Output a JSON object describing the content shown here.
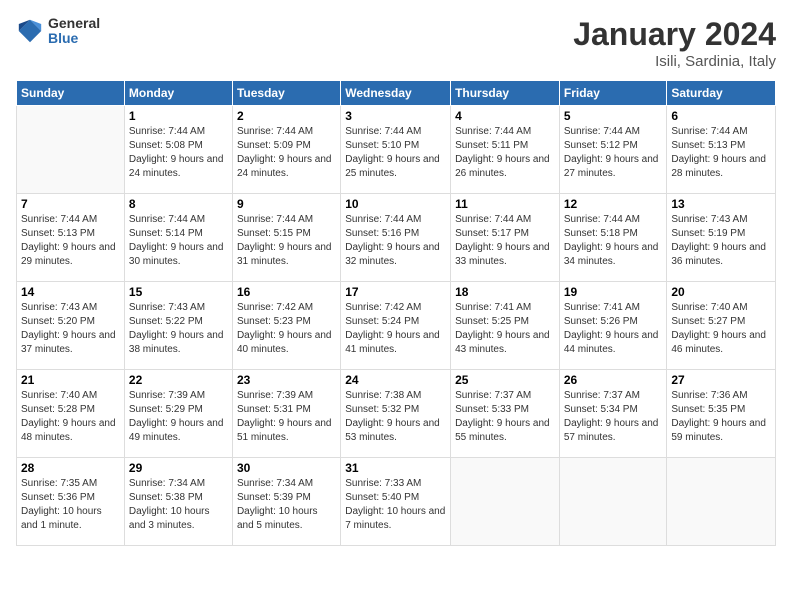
{
  "header": {
    "logo": {
      "general": "General",
      "blue": "Blue"
    },
    "title": "January 2024",
    "location": "Isili, Sardinia, Italy"
  },
  "calendar": {
    "days_of_week": [
      "Sunday",
      "Monday",
      "Tuesday",
      "Wednesday",
      "Thursday",
      "Friday",
      "Saturday"
    ],
    "weeks": [
      [
        {
          "day": "",
          "info": ""
        },
        {
          "day": "1",
          "sunrise": "Sunrise: 7:44 AM",
          "sunset": "Sunset: 5:08 PM",
          "daylight": "Daylight: 9 hours and 24 minutes."
        },
        {
          "day": "2",
          "sunrise": "Sunrise: 7:44 AM",
          "sunset": "Sunset: 5:09 PM",
          "daylight": "Daylight: 9 hours and 24 minutes."
        },
        {
          "day": "3",
          "sunrise": "Sunrise: 7:44 AM",
          "sunset": "Sunset: 5:10 PM",
          "daylight": "Daylight: 9 hours and 25 minutes."
        },
        {
          "day": "4",
          "sunrise": "Sunrise: 7:44 AM",
          "sunset": "Sunset: 5:11 PM",
          "daylight": "Daylight: 9 hours and 26 minutes."
        },
        {
          "day": "5",
          "sunrise": "Sunrise: 7:44 AM",
          "sunset": "Sunset: 5:12 PM",
          "daylight": "Daylight: 9 hours and 27 minutes."
        },
        {
          "day": "6",
          "sunrise": "Sunrise: 7:44 AM",
          "sunset": "Sunset: 5:13 PM",
          "daylight": "Daylight: 9 hours and 28 minutes."
        }
      ],
      [
        {
          "day": "7",
          "sunrise": "Sunrise: 7:44 AM",
          "sunset": "Sunset: 5:13 PM",
          "daylight": "Daylight: 9 hours and 29 minutes."
        },
        {
          "day": "8",
          "sunrise": "Sunrise: 7:44 AM",
          "sunset": "Sunset: 5:14 PM",
          "daylight": "Daylight: 9 hours and 30 minutes."
        },
        {
          "day": "9",
          "sunrise": "Sunrise: 7:44 AM",
          "sunset": "Sunset: 5:15 PM",
          "daylight": "Daylight: 9 hours and 31 minutes."
        },
        {
          "day": "10",
          "sunrise": "Sunrise: 7:44 AM",
          "sunset": "Sunset: 5:16 PM",
          "daylight": "Daylight: 9 hours and 32 minutes."
        },
        {
          "day": "11",
          "sunrise": "Sunrise: 7:44 AM",
          "sunset": "Sunset: 5:17 PM",
          "daylight": "Daylight: 9 hours and 33 minutes."
        },
        {
          "day": "12",
          "sunrise": "Sunrise: 7:44 AM",
          "sunset": "Sunset: 5:18 PM",
          "daylight": "Daylight: 9 hours and 34 minutes."
        },
        {
          "day": "13",
          "sunrise": "Sunrise: 7:43 AM",
          "sunset": "Sunset: 5:19 PM",
          "daylight": "Daylight: 9 hours and 36 minutes."
        }
      ],
      [
        {
          "day": "14",
          "sunrise": "Sunrise: 7:43 AM",
          "sunset": "Sunset: 5:20 PM",
          "daylight": "Daylight: 9 hours and 37 minutes."
        },
        {
          "day": "15",
          "sunrise": "Sunrise: 7:43 AM",
          "sunset": "Sunset: 5:22 PM",
          "daylight": "Daylight: 9 hours and 38 minutes."
        },
        {
          "day": "16",
          "sunrise": "Sunrise: 7:42 AM",
          "sunset": "Sunset: 5:23 PM",
          "daylight": "Daylight: 9 hours and 40 minutes."
        },
        {
          "day": "17",
          "sunrise": "Sunrise: 7:42 AM",
          "sunset": "Sunset: 5:24 PM",
          "daylight": "Daylight: 9 hours and 41 minutes."
        },
        {
          "day": "18",
          "sunrise": "Sunrise: 7:41 AM",
          "sunset": "Sunset: 5:25 PM",
          "daylight": "Daylight: 9 hours and 43 minutes."
        },
        {
          "day": "19",
          "sunrise": "Sunrise: 7:41 AM",
          "sunset": "Sunset: 5:26 PM",
          "daylight": "Daylight: 9 hours and 44 minutes."
        },
        {
          "day": "20",
          "sunrise": "Sunrise: 7:40 AM",
          "sunset": "Sunset: 5:27 PM",
          "daylight": "Daylight: 9 hours and 46 minutes."
        }
      ],
      [
        {
          "day": "21",
          "sunrise": "Sunrise: 7:40 AM",
          "sunset": "Sunset: 5:28 PM",
          "daylight": "Daylight: 9 hours and 48 minutes."
        },
        {
          "day": "22",
          "sunrise": "Sunrise: 7:39 AM",
          "sunset": "Sunset: 5:29 PM",
          "daylight": "Daylight: 9 hours and 49 minutes."
        },
        {
          "day": "23",
          "sunrise": "Sunrise: 7:39 AM",
          "sunset": "Sunset: 5:31 PM",
          "daylight": "Daylight: 9 hours and 51 minutes."
        },
        {
          "day": "24",
          "sunrise": "Sunrise: 7:38 AM",
          "sunset": "Sunset: 5:32 PM",
          "daylight": "Daylight: 9 hours and 53 minutes."
        },
        {
          "day": "25",
          "sunrise": "Sunrise: 7:37 AM",
          "sunset": "Sunset: 5:33 PM",
          "daylight": "Daylight: 9 hours and 55 minutes."
        },
        {
          "day": "26",
          "sunrise": "Sunrise: 7:37 AM",
          "sunset": "Sunset: 5:34 PM",
          "daylight": "Daylight: 9 hours and 57 minutes."
        },
        {
          "day": "27",
          "sunrise": "Sunrise: 7:36 AM",
          "sunset": "Sunset: 5:35 PM",
          "daylight": "Daylight: 9 hours and 59 minutes."
        }
      ],
      [
        {
          "day": "28",
          "sunrise": "Sunrise: 7:35 AM",
          "sunset": "Sunset: 5:36 PM",
          "daylight": "Daylight: 10 hours and 1 minute."
        },
        {
          "day": "29",
          "sunrise": "Sunrise: 7:34 AM",
          "sunset": "Sunset: 5:38 PM",
          "daylight": "Daylight: 10 hours and 3 minutes."
        },
        {
          "day": "30",
          "sunrise": "Sunrise: 7:34 AM",
          "sunset": "Sunset: 5:39 PM",
          "daylight": "Daylight: 10 hours and 5 minutes."
        },
        {
          "day": "31",
          "sunrise": "Sunrise: 7:33 AM",
          "sunset": "Sunset: 5:40 PM",
          "daylight": "Daylight: 10 hours and 7 minutes."
        },
        {
          "day": "",
          "info": ""
        },
        {
          "day": "",
          "info": ""
        },
        {
          "day": "",
          "info": ""
        }
      ]
    ]
  }
}
